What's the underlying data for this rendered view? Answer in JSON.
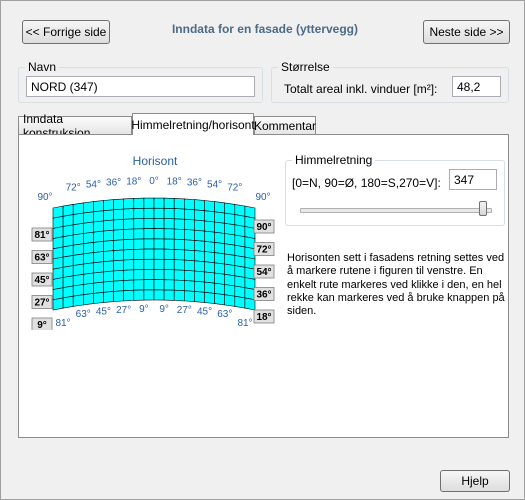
{
  "window": {
    "title": "Inndata for en fasade (yttervegg)"
  },
  "nav": {
    "prev_label": "<< Forrige side",
    "next_label": "Neste side >>"
  },
  "name_group": {
    "legend": "Navn",
    "value": "NORD (347)"
  },
  "size_group": {
    "legend": "Størrelse",
    "label": "Totalt areal inkl. vinduer [m²]:",
    "value": "48,2"
  },
  "tabs": [
    {
      "label": "Inndata konstruksjon",
      "active": false
    },
    {
      "label": "Himmelretning/horisont",
      "active": true
    },
    {
      "label": "Kommentar",
      "active": false
    }
  ],
  "horizon": {
    "title": "Horisont",
    "cell_color": "#00ffff",
    "top_labels": [
      "90°",
      "72°",
      "54°",
      "36°",
      "18°",
      "0°",
      "18°",
      "36°",
      "54°",
      "72°",
      "90°"
    ],
    "bottom_labels": [
      "81°",
      "63°",
      "45°",
      "27°",
      "9°",
      "9°",
      "27°",
      "45°",
      "63°",
      "81°"
    ],
    "left_elev": [
      "81°",
      "63°",
      "45°",
      "27°",
      "9°"
    ],
    "right_elev": [
      "90°",
      "72°",
      "54°",
      "36°",
      "18°"
    ]
  },
  "orientation": {
    "legend": "Himmelretning",
    "label": "[0=N, 90=Ø, 180=S,270=V]:",
    "value": "347",
    "slider_fraction": 0.964
  },
  "help_text": "Horisonten sett i fasadens retning settes ved å markere rutene i figuren til venstre. En enkelt rute markeres ved klikke i den, en hel rekke kan markeres ved å bruke knappen på siden.",
  "help_button": "Hjelp"
}
